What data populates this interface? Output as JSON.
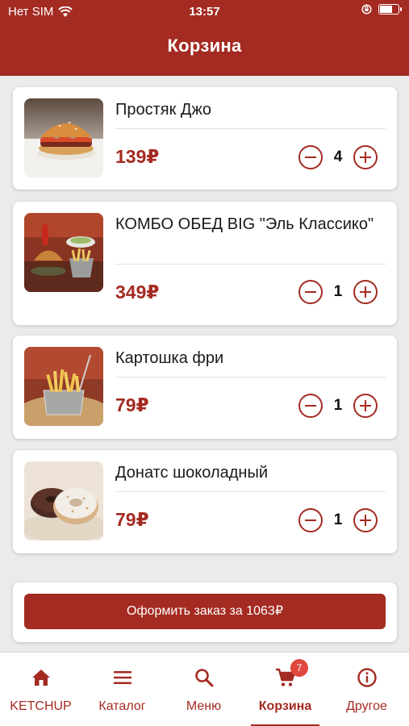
{
  "status_bar": {
    "carrier": "Нет SIM",
    "time": "13:57",
    "battery_level": 0.7
  },
  "header": {
    "title": "Корзина"
  },
  "cart": {
    "items": [
      {
        "name": "Простяк Джо",
        "price": "139₽",
        "quantity": "4",
        "image": "burger-photo"
      },
      {
        "name": "КОМБО ОБЕД BIG \"Эль Классико\"",
        "price": "349₽",
        "quantity": "1",
        "image": "combo-photo"
      },
      {
        "name": "Картошка фри",
        "price": "79₽",
        "quantity": "1",
        "image": "fries-photo"
      },
      {
        "name": "Донатс шоколадный",
        "price": "79₽",
        "quantity": "1",
        "image": "donut-photo"
      }
    ],
    "checkout_label": "Оформить заказ за 1063₽"
  },
  "tabbar": {
    "tabs": [
      {
        "label": "KETCHUP",
        "icon": "home-icon"
      },
      {
        "label": "Каталог",
        "icon": "menu-lines-icon"
      },
      {
        "label": "Меню",
        "icon": "search-icon"
      },
      {
        "label": "Корзина",
        "icon": "cart-icon",
        "badge": "7",
        "active": true
      },
      {
        "label": "Другое",
        "icon": "info-icon"
      }
    ]
  },
  "colors": {
    "brand": "#a42b22",
    "badge": "#e0473d",
    "background": "#ebebeb"
  }
}
